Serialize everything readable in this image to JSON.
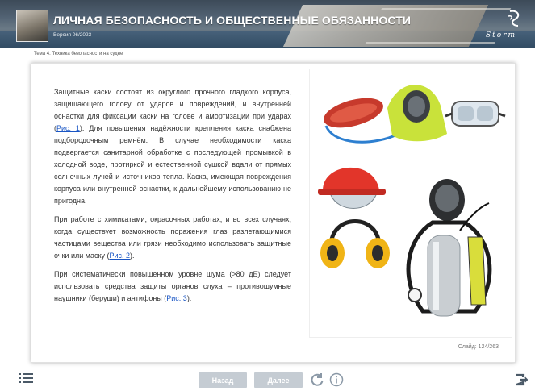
{
  "header": {
    "title": "ЛИЧНАЯ БЕЗОПАСНОСТЬ И ОБЩЕСТВЕННЫЕ ОБЯЗАННОСТИ",
    "version": "Версия 06/2023",
    "logo_text": "Storm"
  },
  "breadcrumb": "Тема 4. Техника безопасности на судне",
  "content": {
    "p1_a": "Защитные каски состоят из округлого прочного гладкого корпуса, защищающего голову от ударов и повреждений, и внутренней оснастки для фиксации каски на голове и амортизации при ударах (",
    "p1_link": "Рис. 1",
    "p1_b": "). Для повышения надёжности крепления каска снабжена подбородочным ремнём. В случае необходимости каска подвергается санитарной обработке с последующей промывкой в холодной воде, протиркой и естественной сушкой вдали от прямых солнечных лучей и источников тепла. Каска, имеющая повреждения корпуса или внутренней оснастки, к дальнейшему использованию не пригодна.",
    "p2_a": "При работе с химикатами, окрасочных работах, и во всех случаях, когда существует возможность поражения глаз разлетающимися частицами вещества или грязи необходимо использовать защитные очки или маску (",
    "p2_link": "Рис. 2",
    "p2_b": ").",
    "p3_a": "При систематически повышенном уровне шума (>80 дБ) следует использовать средства защиты органов слуха – противошумные наушники (беруши) и антифоны (",
    "p3_link": "Рис. 3",
    "p3_b": ")."
  },
  "slide_counter": "Слайд: 124/263",
  "nav": {
    "back_label": "Назад",
    "next_label": "Далее"
  },
  "icons": {
    "menu": "menu-icon",
    "reload": "reload-icon",
    "info": "info-icon",
    "exit": "exit-icon"
  },
  "colors": {
    "button": "#c5ccd3",
    "link": "#1a56c4",
    "icon": "#4b5a68"
  }
}
